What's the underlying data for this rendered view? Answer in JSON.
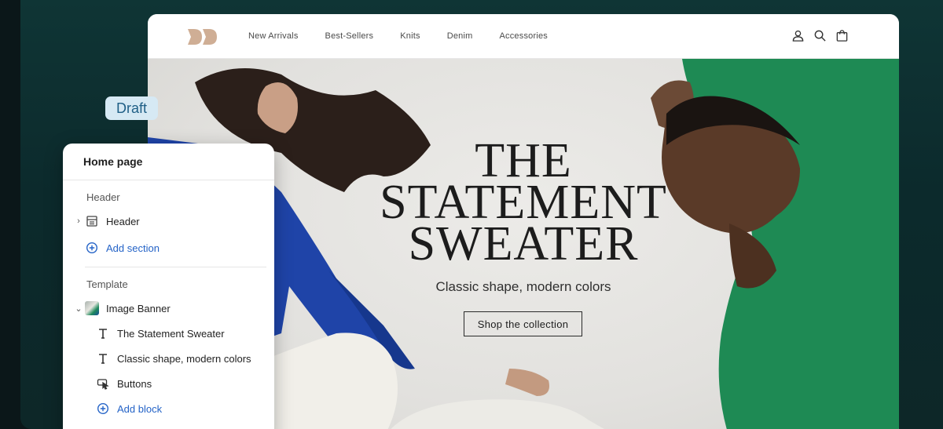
{
  "store": {
    "nav": [
      "New Arrivals",
      "Best-Sellers",
      "Knits",
      "Denim",
      "Accessories"
    ],
    "icons": [
      "account-icon",
      "search-icon",
      "cart-icon"
    ]
  },
  "hero": {
    "title_lines": [
      "THE",
      "STATEMENT",
      "SWEATER"
    ],
    "subtitle": "Classic shape, modern colors",
    "button": "Shop the collection"
  },
  "badge": {
    "label": "Draft"
  },
  "panel": {
    "title": "Home page",
    "header_group": {
      "label": "Header",
      "items": [
        {
          "label": "Header",
          "icon": "header-layout-icon"
        }
      ],
      "add_label": "Add section"
    },
    "template_group": {
      "label": "Template",
      "section": {
        "label": "Image Banner",
        "icon": "image-thumbnail"
      },
      "blocks": [
        {
          "label": "The Statement Sweater",
          "icon": "text-icon"
        },
        {
          "label": "Classic shape, modern colors",
          "icon": "text-icon"
        },
        {
          "label": "Buttons",
          "icon": "button-cursor-icon"
        }
      ],
      "add_label": "Add block"
    }
  },
  "colors": {
    "accent_blue": "#2463c7",
    "badge_bg": "#d6e9f4",
    "badge_text": "#1f5f86",
    "backdrop": "#0f3535",
    "sweater_blue": "#1f44a8",
    "sweater_green": "#1e8a54"
  }
}
